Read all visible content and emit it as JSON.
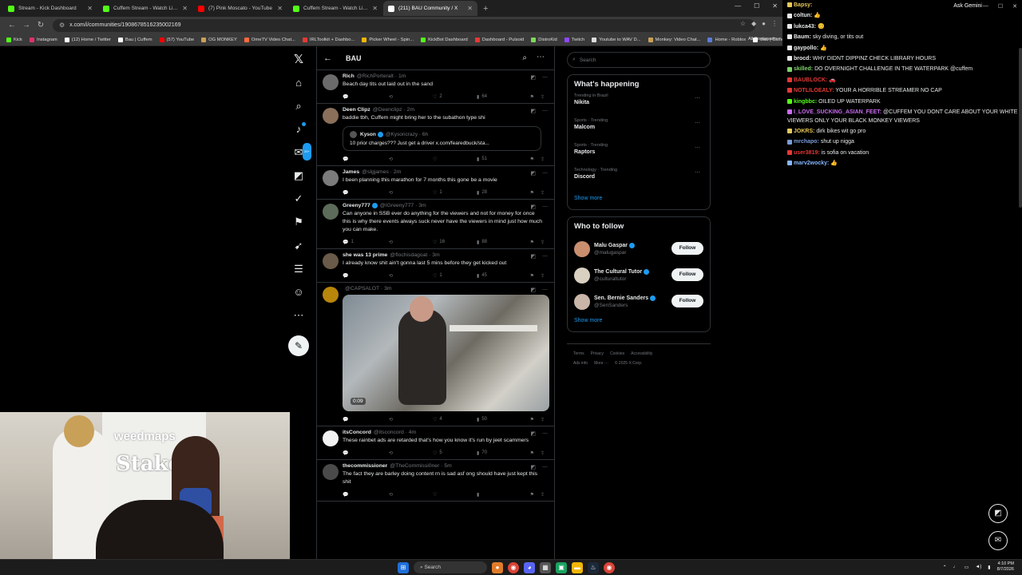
{
  "browser": {
    "tabs": [
      {
        "label": "Stream - Kick Dashboard",
        "color": "#53fc18",
        "active": false
      },
      {
        "label": "Cuffem Stream - Watch Live on",
        "color": "#53fc18",
        "active": false
      },
      {
        "label": "(7) Pink Moscato - YouTube",
        "color": "#ff0000",
        "active": false
      },
      {
        "label": "Cuffem Stream - Watch Live on",
        "color": "#53fc18",
        "active": false
      },
      {
        "label": "(211) BAU Community / X",
        "color": "#ffffff",
        "active": true
      }
    ],
    "new_tab": "+",
    "url": "x.com/i/communities/1908678516235002169",
    "bookmarks": [
      {
        "label": "Kick",
        "color": "#53fc18"
      },
      {
        "label": "Instagram",
        "color": "#e1306c"
      },
      {
        "label": "(12) Home / Twitter",
        "color": "#ffffff"
      },
      {
        "label": "Bau | Cuffem",
        "color": "#ffffff"
      },
      {
        "label": "(57) YouTube",
        "color": "#ff0000"
      },
      {
        "label": "OG MONKEY",
        "color": "#c9a057"
      },
      {
        "label": "OmeTV Video Chat...",
        "color": "#ff6a3d"
      },
      {
        "label": "IRLToolkit + Dashbo...",
        "color": "#e53935"
      },
      {
        "label": "Picker Wheel - Spin...",
        "color": "#f2b705"
      },
      {
        "label": "KickBot Dashboard",
        "color": "#53fc18"
      },
      {
        "label": "Dashboard - Pulsoid",
        "color": "#e53935"
      },
      {
        "label": "DistroKid",
        "color": "#7ed957"
      },
      {
        "label": "Twitch",
        "color": "#9146ff"
      },
      {
        "label": "Youtube to WAV D...",
        "color": "#dddddd"
      },
      {
        "label": "Monkey: Video Chat...",
        "color": "#c9a057"
      },
      {
        "label": "Home - Roblox",
        "color": "#5a7bd8"
      },
      {
        "label": "Bau | Cuffem",
        "color": "#ffffff"
      },
      {
        "label": "UFC 326: Holloway...",
        "color": "#d20a0a"
      }
    ],
    "all_bookmarks": "All Bookmarks"
  },
  "x": {
    "community_title": "BAU",
    "nav_badge": "20+",
    "posts": [
      {
        "name": "Rich",
        "handle": "@RichPorteralt · 1m",
        "verified": false,
        "avatar": "#6b6b6b",
        "text": "Beach day tits out laid out in the sand",
        "replies": "",
        "reposts": "",
        "likes": "2",
        "views": "64"
      },
      {
        "name": "Deen Clipz",
        "handle": "@Deenclipz · 2m",
        "verified": false,
        "avatar": "#8a6f5a",
        "text": "baddie tbh, Cuffem might bring her to the subathon type shi",
        "quote": {
          "name": "Kyson",
          "handle": "@Kysoncrazy · 6h",
          "text": "10 prior charges??? Just get a driver x.com/fearedbuck/sta..."
        },
        "replies": "",
        "reposts": "",
        "likes": "",
        "views": "51"
      },
      {
        "name": "James",
        "handle": "@slgjames · 2m",
        "verified": false,
        "avatar": "#7b7b7b",
        "text": "I been planning this marathon for 7 months this gone be a movie",
        "replies": "",
        "reposts": "",
        "likes": "1",
        "views": "28"
      },
      {
        "name": "Greeny777",
        "handle": "@IGreeny777 · 3m",
        "verified": true,
        "avatar": "#5d6b5a",
        "text": "Can anyone in SSB ever do anything for the viewers and not for money for once this is why there events always suck never have the viewers in mind just how much you can make.",
        "replies": "1",
        "reposts": "",
        "likes": "16",
        "views": "88"
      },
      {
        "name": "she was 13 prime",
        "handle": "@flochisdagoat · 3m",
        "verified": false,
        "avatar": "#6a5a4a",
        "text": "I already know shit ain't gonna last 5 mins before they get kicked out",
        "replies": "",
        "reposts": "",
        "likes": "1",
        "views": "45"
      },
      {
        "name": "",
        "handle": "@CAPSALOT · 3m",
        "verified": false,
        "avatar": "#b8860b",
        "text": "",
        "media": {
          "duration": "0:09"
        },
        "replies": "",
        "reposts": "",
        "likes": "4",
        "views": "50"
      },
      {
        "name": "itsConcord",
        "handle": "@itsconcord · 4m",
        "verified": false,
        "avatar": "#f2f2f2",
        "text": "These rainbet ads are retarded that's how you know it's run by jeet scammers",
        "replies": "",
        "reposts": "",
        "likes": "5",
        "views": "70"
      },
      {
        "name": "thecommissioner",
        "handle": "@TheCommissi0ner · 5m",
        "verified": false,
        "avatar": "#4a4a4a",
        "text": "The fact they are barley doing content rn is sad asf ong should have just kept this shit",
        "replies": "",
        "reposts": "",
        "likes": "",
        "views": ""
      }
    ],
    "search_placeholder": "Search",
    "happening_title": "What's happening",
    "trends": [
      {
        "context": "Trending in Brazil",
        "name": "Nikita"
      },
      {
        "context": "Sports · Trending",
        "name": "Malcom"
      },
      {
        "context": "Sports · Trending",
        "name": "Raptors"
      },
      {
        "context": "Technology · Trending",
        "name": "Discord"
      }
    ],
    "show_more": "Show more",
    "follow_title": "Who to follow",
    "follow": [
      {
        "name": "Malu Gaspar",
        "handle": "@malugaspar",
        "avatar": "#c98f6e",
        "button": "Follow"
      },
      {
        "name": "The Cultural Tutor",
        "handle": "@culturaltutor",
        "avatar": "#d8d0c0",
        "button": "Follow"
      },
      {
        "name": "Sen. Bernie Sanders",
        "handle": "@SenSanders",
        "avatar": "#c9b6a8",
        "button": "Follow"
      }
    ],
    "footer": [
      "Terms",
      "Privacy",
      "Cookies",
      "Accessibility",
      "Ads info",
      "More ···",
      "© 2025 X Corp."
    ]
  },
  "webcam": {
    "logo_top": "weedmaps",
    "logo_bottom": "Stake"
  },
  "chat": {
    "ask_gemini": "Ask Gemini",
    "messages": [
      {
        "user": "Bapsy:",
        "color": "#e7c85a",
        "text": ""
      },
      {
        "user": "coltun:",
        "color": "#e7e9ea",
        "text": "👍"
      },
      {
        "user": "lukca43:",
        "color": "#e7e9ea",
        "text": "😊"
      },
      {
        "user": "Baum:",
        "color": "#e7e9ea",
        "text": "sky diving, or tits out"
      },
      {
        "user": "gaypollo:",
        "color": "#e7e9ea",
        "text": "👍"
      },
      {
        "user": "brocd:",
        "color": "#e7e9ea",
        "text": "WHY DIDNT DIPPINZ CHECK LIBRARY HOURS"
      },
      {
        "user": "skilled:",
        "color": "#7fd36b",
        "text": "DO OVERNIGHT CHALLENGE IN THE WATERPARK @cuffem"
      },
      {
        "user": "BAUBLOCK:",
        "color": "#e53935",
        "text": "🚗"
      },
      {
        "user": "NOTLILOEALY:",
        "color": "#e53935",
        "text": "YOUR A HORRIBLE STREAMER NO CAP"
      },
      {
        "user": "kingbbc:",
        "color": "#53fc18",
        "text": "OILED UP WATERPARK"
      },
      {
        "user": "I_LOVE_SUCKING_ASIAN_FEET:",
        "color": "#c86cf0",
        "text": "@CUFFEM YOU DONT CARE ABOUT YOUR WHITE VIEWERS ONLY YOUR BLACK MONKEY VIEWERS",
        "wrap": true
      },
      {
        "user": "JOKRS:",
        "color": "#e7c85a",
        "text": "dirk bikes wit go pro"
      },
      {
        "user": "mrchapo:",
        "color": "#7a9cd8",
        "text": "shut up nigga"
      },
      {
        "user": "user3819:",
        "color": "#e53935",
        "text": "is sofia on vacation"
      },
      {
        "user": "marv2wocky:",
        "color": "#86b6ff",
        "text": "👍"
      }
    ]
  },
  "taskbar": {
    "search": "Search",
    "time": "4:10 PM",
    "date": "8/7/2026"
  }
}
